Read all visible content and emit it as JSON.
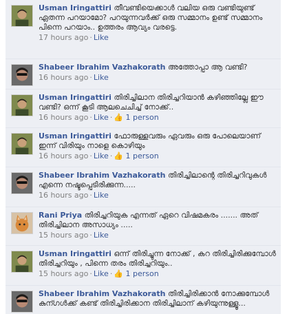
{
  "comments": [
    {
      "author": "Usman Iringattiri",
      "text": "തീവണ്ടിയെക്കാൾ വലിയ ഒരു വണ്ടിയുണ്ട് ഏതന്ന പറയാമോ? പറയുന്നവർക്ക് ഒരു സമ്മാനം ഉണ്ട് സമ്മാനം പിന്നെ പറയാം.. ഉത്തരം ആവ്യം വരട്ടെ.",
      "time": "17 hours ago",
      "like_label": "Like",
      "likes": ""
    },
    {
      "author": "Shabeer Ibrahim Vazhakorath",
      "text": "അത്തോപ്പാ ആ വണ്ടി?",
      "time": "16 hours ago",
      "like_label": "Like",
      "likes": ""
    },
    {
      "author": "Usman Iringattiri",
      "text": "തിരിച്ചിലാന തിരിച്ചറിയാൻ കഴിഞ്ഞില്ലേ ഈ വണ്ടി? ഒന്ന് കൂടി ആലചെചിച്ച് നോക്ക്..",
      "time": "16 hours ago",
      "like_label": "Like",
      "likes": "1 person"
    },
    {
      "author": "Usman Iringattiri",
      "text": "ഫോരുള്ളവരും ഏവരും ഒരു പോലെയാണ് ഇന്ന് വിരിയും നാളെ കൊഴിയും",
      "time": "16 hours ago",
      "like_label": "Like",
      "likes": "1 person"
    },
    {
      "author": "Shabeer Ibrahim Vazhakorath",
      "text": "തിരിച്ചിലാന്റെ തിരിച്ചറിവുകൾ എന്നെ നഷ്ടപ്പെടിരിക്കുന്ന.....",
      "time": "16 hours ago",
      "like_label": "Like",
      "likes": ""
    },
    {
      "author": "Rani Priya",
      "text": "തിരിച്ചറിയുക എന്നത് ഏറെ വിഷമകരം ....... അത് തിരിച്ചിലാന അസാധ്യം .....",
      "time": "15 hours ago",
      "like_label": "Like",
      "likes": ""
    },
    {
      "author": "Usman Iringattiri",
      "text": "ഒന്ന് തിരിച്ചുന്ന നോക്ക് , കറ തിരിച്ചിരിക്കുമ്പോൾ തിരിച്ചറിയും , പിന്നെ തരം തിരിച്ചറിയും..",
      "time": "15 hours ago",
      "like_label": "Like",
      "likes": "1 person"
    },
    {
      "author": "Shabeer Ibrahim Vazhakorath",
      "text": "തിരിച്ചിരിക്കാൻ നോക്കുമ്പോൾ കുന്ഗൾക്ക് കണ്ട് തിരിച്ചിരിക്കാന തിരിച്ചിലാന് കഴിയുന്നുള്ളൂ...",
      "time": "",
      "like_label": "",
      "likes": ""
    }
  ],
  "avatars": {
    "usman": {
      "bg": "#7f8a4e",
      "face": "#c8a07a",
      "hair": "#2b241c",
      "shirt": "#3c4b2a"
    },
    "shabeer": {
      "bg": "#6a6a6a",
      "face": "#b88a74",
      "hair": "#1e1a18",
      "glasses": "#111111"
    },
    "rani": {
      "bg": "#d7c2a6",
      "fur": "#d9893b",
      "ear": "#f0c59a",
      "eye": "#2b2b2b"
    }
  }
}
